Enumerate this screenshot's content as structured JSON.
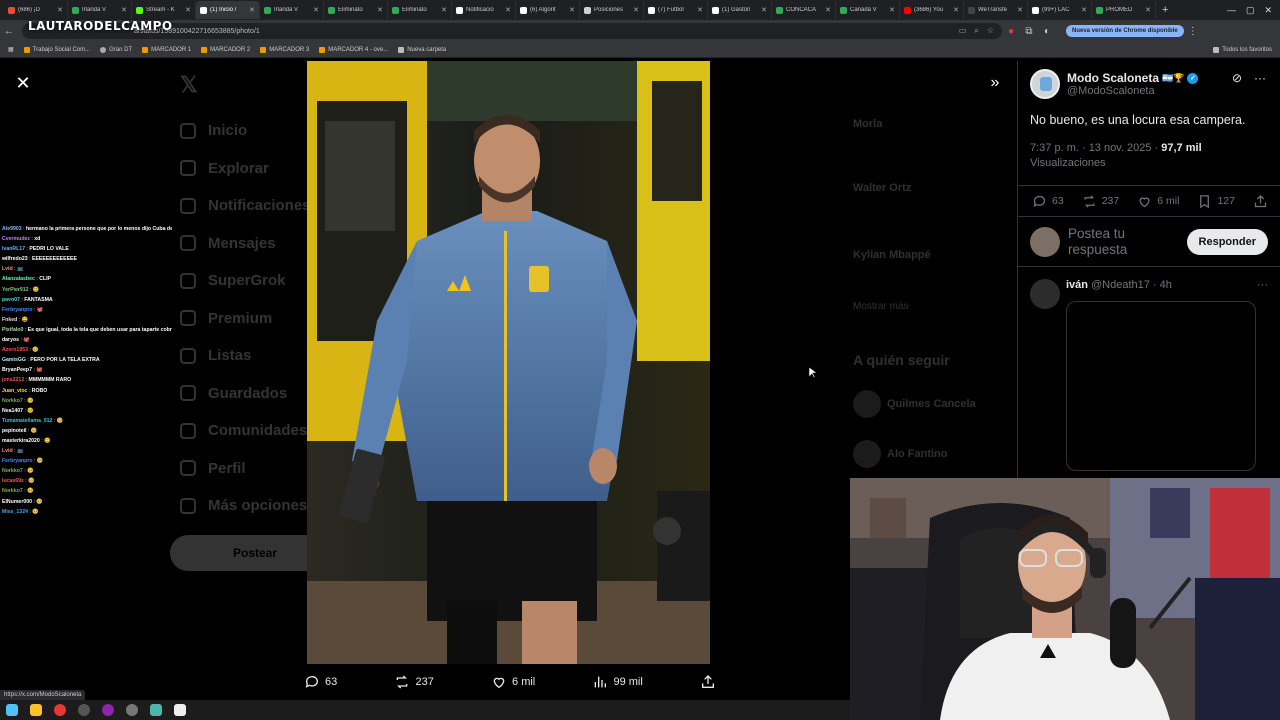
{
  "browser": {
    "tabs": [
      {
        "label": "(686) ¡D",
        "color": "#e74c3c"
      },
      {
        "label": "Irlanda V",
        "color": "#3ba55c"
      },
      {
        "label": "Stream - K",
        "color": "#53fc18"
      },
      {
        "label": "(1) Inicio /",
        "color": "#ffffff",
        "active": true
      },
      {
        "label": "Irlanda V",
        "color": "#3ba55c"
      },
      {
        "label": "Eliminato",
        "color": "#3ba55c"
      },
      {
        "label": "Eliminato",
        "color": "#3ba55c"
      },
      {
        "label": "Notificacio",
        "color": "#ffffff"
      },
      {
        "label": "(6) Algorit",
        "color": "#ffffff"
      },
      {
        "label": "Posiciones",
        "color": "#d0d0d0"
      },
      {
        "label": "(7) Futbol",
        "color": "#ffffff"
      },
      {
        "label": "(1) Gastón",
        "color": "#ffffff"
      },
      {
        "label": "CONCACA",
        "color": "#3ba55c"
      },
      {
        "label": "Canadá V",
        "color": "#3ba55c"
      },
      {
        "label": "(3686) You",
        "color": "#ff0000"
      },
      {
        "label": "WeTransfe",
        "color": "#444444"
      },
      {
        "label": "(99+) LAC",
        "color": "#ffffff"
      },
      {
        "label": "PROMED",
        "color": "#3ba55c"
      }
    ],
    "url": "x.com/Scaloneta/status/1989100422716653885/photo/1",
    "url_short": "a/status/1989100422716653885/photo/1",
    "update_label": "Nueva versión de Chrome disponible",
    "bookmarks": [
      "Trabajo Social Com...",
      "Gran DT",
      "MARCADOR 1",
      "MARCADOR 2",
      "MARCADOR 3",
      "MARCADOR 4 - ove...",
      "Nueva carpeta"
    ],
    "all_bookmarks": "Todos los favoritos"
  },
  "stream_logo": "LAUTARODELCAMPO",
  "x_sidebar": {
    "items": [
      "Inicio",
      "Explorar",
      "Notificaciones",
      "Mensajes",
      "SuperGrok",
      "Premium",
      "Listas",
      "Guardados",
      "Comunidades",
      "Perfil",
      "Más opciones"
    ],
    "post_label": "Postear"
  },
  "x_right_dim": {
    "trend1": "Morla",
    "trend2": "Walter Ortz",
    "trend3": "Kylian Mbappé",
    "more": "Mostrar más",
    "follow_title": "A quién seguir",
    "follow1": "Quilmes Cancela",
    "follow2": "Alo Fantino"
  },
  "chat": [
    {
      "user": "Ale9903",
      "color": "#8ab4f8",
      "msg": "hermano la primera persone que por lo menos dijo Cuba despues de MiaKalifa gracias nene enre grande"
    },
    {
      "user": "Cvermudez",
      "color": "#b388ff",
      "msg": "xd"
    },
    {
      "user": "IvanRL17",
      "color": "#64b5f6",
      "msg": "PEDRI LO VALE"
    },
    {
      "user": "wilfredo23",
      "color": "#ffffff",
      "msg": "EEEEEEEEEEEEE"
    },
    {
      "user": "Lvid",
      "color": "#ff8a80",
      "msg": "📺"
    },
    {
      "user": "Alanzalasbec",
      "color": "#69f0ae",
      "msg": "CLIP"
    },
    {
      "user": "YerPier912",
      "color": "#81c784",
      "msg": "😊"
    },
    {
      "user": "pavo07",
      "color": "#4dd0e1",
      "msg": "FANTASMA"
    },
    {
      "user": "Ferbryanpro",
      "color": "#448aff",
      "msg": "🐙"
    },
    {
      "user": "Fnked",
      "color": "#e0e0e0",
      "msg": "😀"
    },
    {
      "user": "Pixifalo0",
      "color": "#a5d6a7",
      "msg": "Es que igual, toda la tela que deben usar para taparte cobrix"
    },
    {
      "user": "daryos",
      "color": "#ffffff",
      "msg": "🐙"
    },
    {
      "user": "Azero1953",
      "color": "#ff5252",
      "msg": "🥺"
    },
    {
      "user": "GamisGG",
      "color": "#b2ebf2",
      "msg": "PERO POR LA TELA EXTRA"
    },
    {
      "user": "BryanPeep7",
      "color": "#ffffff",
      "msg": "🐙"
    },
    {
      "user": "jons2212",
      "color": "#ff5252",
      "msg": "MMMMMM RARO"
    },
    {
      "user": "Juan_vioc",
      "color": "#ffd54f",
      "msg": "ROBO"
    },
    {
      "user": "Norkko7",
      "color": "#7cb342",
      "msg": "🥺"
    },
    {
      "user": "Nea1407",
      "color": "#ffffff",
      "msg": "🥺"
    },
    {
      "user": "Tumamatellama_912",
      "color": "#26c6da",
      "msg": "🥺"
    },
    {
      "user": "pepinoteil",
      "color": "#ffffff",
      "msg": "🥺"
    },
    {
      "user": "masterkira2020",
      "color": "#ffffff",
      "msg": "😊"
    },
    {
      "user": "Lvid",
      "color": "#ff8a80",
      "msg": "📺"
    },
    {
      "user": "Ferbryanpro",
      "color": "#448aff",
      "msg": "🥺"
    },
    {
      "user": "Norkko7",
      "color": "#7cb342",
      "msg": "🥺"
    },
    {
      "user": "lucas69z",
      "color": "#ff5252",
      "msg": "🥺"
    },
    {
      "user": "Norkko7",
      "color": "#7cb342",
      "msg": "🥺"
    },
    {
      "user": "ElNumer000",
      "color": "#ffffff",
      "msg": "🥺"
    },
    {
      "user": "Miss_1324",
      "color": "#42a5f5",
      "msg": "🥺"
    }
  ],
  "photo_bar": {
    "comments": "63",
    "reposts": "237",
    "likes": "6 mil",
    "views": "99 mil"
  },
  "tweet": {
    "display_name": "Modo Scaloneta",
    "badge_emoji": "🇦🇷🏆",
    "handle": "@ModoScaloneta",
    "text": "No bueno, es una locura esa campera.",
    "time": "7:37 p. m. · 13 nov. 2025 ·",
    "views_count": "97,7 mil",
    "views_label": "Visualizaciones",
    "comments": "63",
    "reposts": "237",
    "likes": "6 mil",
    "bookmarks": "127",
    "reply_placeholder": "Postea tu respuesta",
    "reply_button": "Responder"
  },
  "comment": {
    "name": "iván",
    "handle": "@Ndeath17",
    "age": "· 4h"
  },
  "status_url": "https://x.com/ModoScaloneta",
  "colors": {
    "accent_blue": "#1d9bf0",
    "jacket": "#5a7fae",
    "bus_yellow": "#e6c514"
  }
}
